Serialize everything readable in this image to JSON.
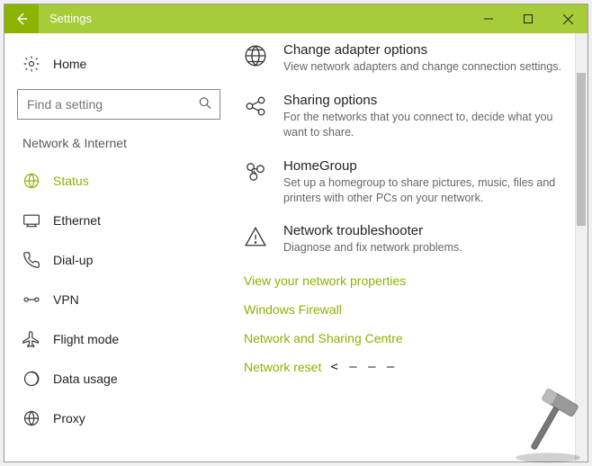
{
  "titlebar": {
    "title": "Settings"
  },
  "sidebar": {
    "home_label": "Home",
    "search_placeholder": "Find a setting",
    "category": "Network & Internet",
    "items": [
      {
        "label": "Status"
      },
      {
        "label": "Ethernet"
      },
      {
        "label": "Dial-up"
      },
      {
        "label": "VPN"
      },
      {
        "label": "Flight mode"
      },
      {
        "label": "Data usage"
      },
      {
        "label": "Proxy"
      }
    ]
  },
  "main": {
    "options": [
      {
        "title": "Change adapter options",
        "desc": "View network adapters and change connection settings."
      },
      {
        "title": "Sharing options",
        "desc": "For the networks that you connect to, decide what you want to share."
      },
      {
        "title": "HomeGroup",
        "desc": "Set up a homegroup to share pictures, music, files and printers with other PCs on your network."
      },
      {
        "title": "Network troubleshooter",
        "desc": "Diagnose and fix network problems."
      }
    ],
    "links": {
      "view_props": "View your network properties",
      "firewall": "Windows Firewall",
      "sharing_centre": "Network and Sharing Centre",
      "network_reset": "Network reset"
    },
    "annotation": "< – – –"
  }
}
